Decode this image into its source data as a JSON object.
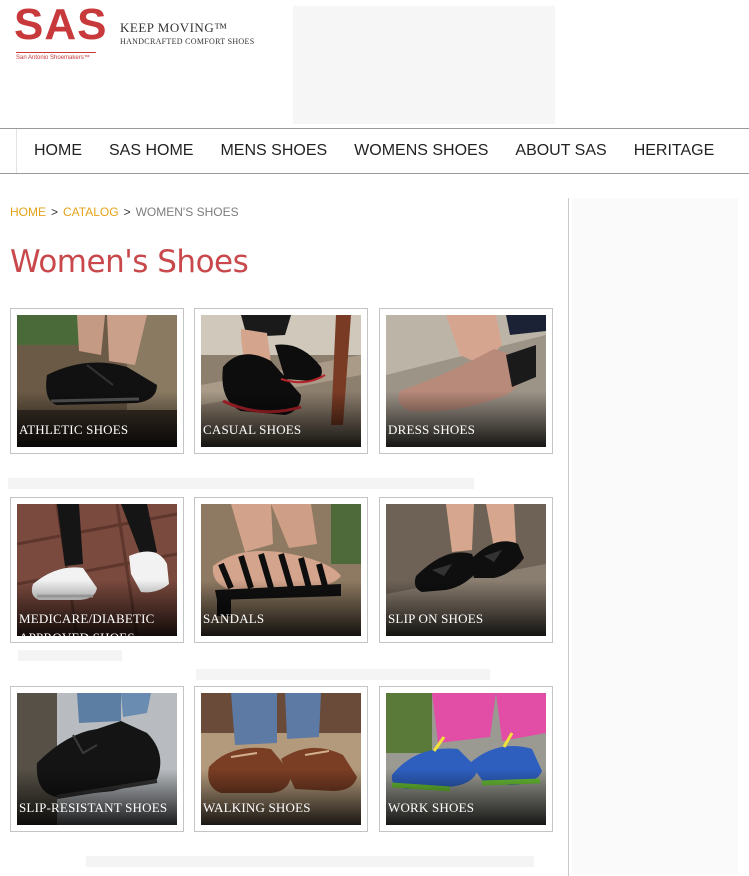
{
  "header": {
    "logo_letters": "SAS",
    "logo_subtitle": "San Antonio Shoemakers™",
    "tagline": "KEEP MOVING™",
    "tagline_sub": "HANDCRAFTED COMFORT SHOES"
  },
  "nav": {
    "items": [
      {
        "label": "HOME"
      },
      {
        "label": "SAS HOME"
      },
      {
        "label": "MENS SHOES"
      },
      {
        "label": "WOMENS SHOES"
      },
      {
        "label": "ABOUT SAS"
      },
      {
        "label": "HERITAGE"
      }
    ]
  },
  "breadcrumb": {
    "home": "HOME",
    "separator": ">",
    "catalog": "CATALOG",
    "current": "WOMEN'S SHOES"
  },
  "page": {
    "title": "Women's Shoes"
  },
  "categories": [
    {
      "label": "ATHLETIC SHOES",
      "icon": "athletic-shoe-photo"
    },
    {
      "label": "CASUAL SHOES",
      "icon": "casual-shoe-photo"
    },
    {
      "label": "DRESS SHOES",
      "icon": "dress-shoe-photo"
    },
    {
      "label": "MEDICARE/DIABETIC APPROVED SHOES",
      "icon": "medicare-shoe-photo"
    },
    {
      "label": "SANDALS",
      "icon": "sandal-photo"
    },
    {
      "label": "SLIP ON SHOES",
      "icon": "slip-on-shoe-photo"
    },
    {
      "label": "SLIP-RESISTANT SHOES",
      "icon": "slip-resistant-shoe-photo"
    },
    {
      "label": "WALKING SHOES",
      "icon": "walking-shoe-photo"
    },
    {
      "label": "WORK SHOES",
      "icon": "work-shoe-photo"
    }
  ],
  "colors": {
    "brand_red": "#c8393b",
    "title_red": "#c8484b",
    "breadcrumb_link": "#e3a21a",
    "breadcrumb_current": "#7d7d7d"
  }
}
